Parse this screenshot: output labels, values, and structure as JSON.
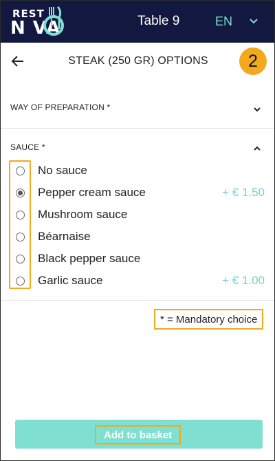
{
  "header": {
    "logo_top": "REST",
    "logo_bottom": "N VA",
    "table": "Table 9",
    "language": "EN"
  },
  "page": {
    "title": "STEAK (250 GR) OPTIONS",
    "count": "2"
  },
  "sections": [
    {
      "label": "WAY OF PREPARATION *",
      "expanded": false
    },
    {
      "label": "SAUCE *",
      "expanded": true
    }
  ],
  "sauce_options": [
    {
      "label": "No sauce",
      "price": "",
      "selected": false
    },
    {
      "label": "Pepper cream sauce",
      "price": "+ € 1.50",
      "selected": true
    },
    {
      "label": "Mushroom sauce",
      "price": "",
      "selected": false
    },
    {
      "label": "Béarnaise",
      "price": "",
      "selected": false
    },
    {
      "label": "Black pepper sauce",
      "price": "",
      "selected": false
    },
    {
      "label": "Garlic sauce",
      "price": "+ € 1.00",
      "selected": false
    }
  ],
  "mandatory_note": "* = Mandatory choice",
  "add_button": "Add to basket",
  "colors": {
    "header_bg": "#121840",
    "accent_teal": "#7fe0d1",
    "price_teal": "#6fd6c3",
    "badge_orange": "#f2a91c"
  },
  "icons": {
    "back": "arrow-left-icon",
    "lang_dropdown": "chevron-down-icon",
    "section_collapsed": "chevron-down-icon",
    "section_expanded": "chevron-up-icon"
  }
}
